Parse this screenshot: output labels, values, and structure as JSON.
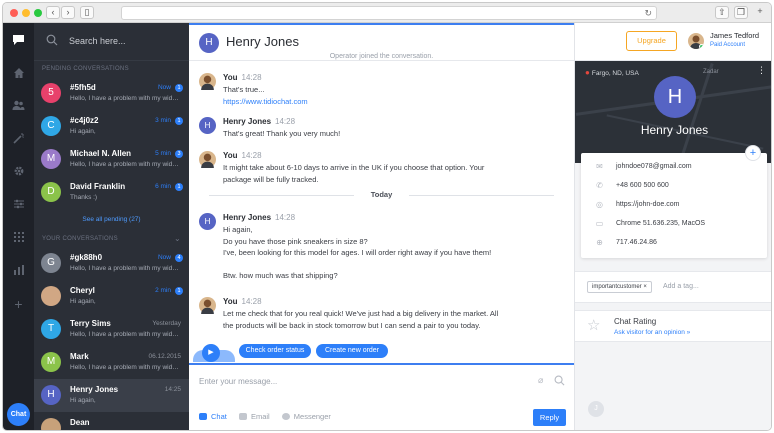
{
  "browser": {
    "nav_back": "‹",
    "nav_forward": "›",
    "tabs_icon": "sidebar-icon",
    "reload": "↻",
    "share_icon": "share-icon",
    "tabs_overview_icon": "tabs-icon"
  },
  "colors": {
    "accent": "#2d7ff9",
    "sidebar_bg": "#2b2f37",
    "rail_bg": "#1e2128",
    "upgrade": "#f5a623",
    "avatar_purple": "#5664c4"
  },
  "rail": {
    "items": [
      "chat-bubble-icon",
      "home-icon",
      "visitors-icon",
      "wand-icon",
      "settings-icon",
      "sliders-icon",
      "apps-grid-icon",
      "stats-icon",
      "add-icon"
    ],
    "chat_button": "Chat"
  },
  "conversations": {
    "search_placeholder": "Search here...",
    "pending_header": "PENDING CONVERSATIONS",
    "pending": [
      {
        "initial": "5",
        "name": "#5fh5d",
        "preview": "Hello, I have a problem with my widget",
        "time": "Now",
        "badge": "1",
        "color": "#e8416b"
      },
      {
        "initial": "C",
        "name": "#c4j0z2",
        "preview": "Hi again,",
        "time": "3 min",
        "badge": "1",
        "color": "#2fa7e6"
      },
      {
        "initial": "M",
        "name": "Michael N. Allen",
        "preview": "Hello, I have a problem with my widget",
        "time": "5 min",
        "badge": "3",
        "color": "#9a7ac9"
      },
      {
        "initial": "D",
        "name": "David Franklin",
        "preview": "Thanks :)",
        "time": "6 min",
        "badge": "1",
        "color": "#8bc34a"
      }
    ],
    "see_all": "See all pending (27)",
    "yours_header": "YOUR CONVERSATIONS",
    "yours": [
      {
        "initial": "G",
        "name": "#gk88h0",
        "preview": "Hello, I have a problem with my widget",
        "time": "Now",
        "badge": "4",
        "color": "#7d8490",
        "grey": false
      },
      {
        "initial": "",
        "name": "Cheryl",
        "preview": "Hi again,",
        "time": "2 min",
        "badge": "1",
        "color": "#d1a784",
        "grey": false
      },
      {
        "initial": "T",
        "name": "Terry Sims",
        "preview": "Hello, I have a problem with my widget",
        "time": "Yesterday",
        "badge": "",
        "color": "#2fa7e6",
        "grey": true
      },
      {
        "initial": "M",
        "name": "Mark",
        "preview": "Hello, I have a problem with my widget",
        "time": "06.12.2015",
        "badge": "",
        "color": "#8bc34a",
        "grey": true
      },
      {
        "initial": "H",
        "name": "Henry Jones",
        "preview": "Hi again,",
        "time": "14:25",
        "badge": "",
        "color": "#5664c4",
        "grey": true
      },
      {
        "initial": "",
        "name": "Dean",
        "preview": "",
        "time": "",
        "badge": "",
        "color": "#c7a17a",
        "grey": true
      }
    ]
  },
  "chat": {
    "visitor_initial": "H",
    "visitor_name": "Henry Jones",
    "system_message": "Operator joined the conversation.",
    "day_separator": "Today",
    "messages": [
      {
        "who": "You",
        "time": "14:28",
        "lines": [
          "That's true..."
        ],
        "link": "https://www.tidiochat.com"
      },
      {
        "who": "Henry Jones",
        "time": "14:28",
        "lines": [
          "That's great! Thank you very much!"
        ],
        "link": ""
      },
      {
        "who": "You",
        "time": "14:28",
        "lines": [
          "It might take about 6-10 days to arrive in the UK if you choose that option. Your",
          "package will be fully tracked."
        ],
        "link": ""
      },
      {
        "who": "Henry Jones",
        "time": "14:28",
        "lines": [
          "Hi again,",
          "Do you have those pink sneakers in size 8?",
          "I've, been looking for this model for ages. I will order right away if you have them!",
          "",
          "Btw. how much was that shipping?"
        ],
        "link": ""
      },
      {
        "who": "You",
        "time": "14:28",
        "lines": [
          "Let me check that for you real quick! We've just had a big delivery in the market. All",
          "the products will be back in stock tomorrow but I can send a pair to you today."
        ],
        "link": ""
      }
    ],
    "quick_replies": [
      "Check order status",
      "Create new order"
    ],
    "composer_placeholder": "Enter your message...",
    "channels": [
      "Chat",
      "Email",
      "Messenger"
    ],
    "reply_label": "Reply"
  },
  "panel": {
    "upgrade_label": "Upgrade",
    "agent_name": "James Tedford",
    "agent_plan": "Paid Account",
    "location": "Fargo, ND, USA",
    "map_label": "Zadar",
    "visitor_initial": "H",
    "visitor_name": "Henry Jones",
    "info": [
      {
        "icon": "email-icon",
        "glyph": "✉",
        "value": "johndoe078@gmail.com"
      },
      {
        "icon": "phone-icon",
        "glyph": "✆",
        "value": "+48 600 500 600"
      },
      {
        "icon": "globe-icon",
        "glyph": "◎",
        "value": "https://john-doe.com"
      },
      {
        "icon": "browser-icon",
        "glyph": "▭",
        "value": "Chrome 51.636.235, MacOS"
      },
      {
        "icon": "ip-icon",
        "glyph": "⊕",
        "value": "717.46.24.86"
      }
    ],
    "tag": "importantcustomer",
    "tag_remove": "×",
    "add_tag_placeholder": "Add a tag...",
    "rating_title": "Chat Rating",
    "rating_sub": "Ask visitor for an opinion »"
  }
}
